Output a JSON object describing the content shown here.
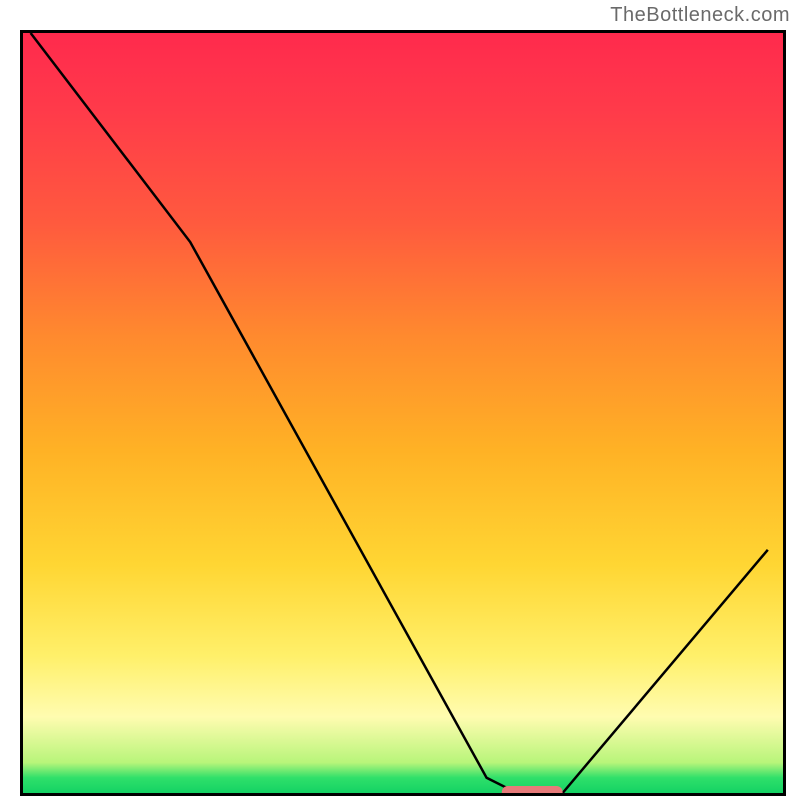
{
  "watermark": "TheBottleneck.com",
  "chart_data": {
    "type": "line",
    "title": "",
    "xlabel": "",
    "ylabel": "",
    "xlim": [
      0,
      100
    ],
    "ylim": [
      0,
      100
    ],
    "grid": false,
    "legend": false,
    "series": [
      {
        "name": "bottleneck-curve",
        "x": [
          1,
          22,
          61,
          65,
          71,
          98
        ],
        "values": [
          100,
          72.5,
          2,
          0,
          0,
          32
        ]
      }
    ],
    "marker": {
      "name": "optimal-range",
      "shape": "pill",
      "color": "#e77b7a",
      "x_start": 63,
      "x_end": 71,
      "y": 0
    },
    "background": {
      "type": "vertical-gradient",
      "stops": [
        {
          "pos": 0,
          "color": "#ff2a4d"
        },
        {
          "pos": 25,
          "color": "#ff5a3e"
        },
        {
          "pos": 55,
          "color": "#ffb225"
        },
        {
          "pos": 82,
          "color": "#fff06a"
        },
        {
          "pos": 96,
          "color": "#b8f57a"
        },
        {
          "pos": 100,
          "color": "#14d264"
        }
      ]
    }
  }
}
